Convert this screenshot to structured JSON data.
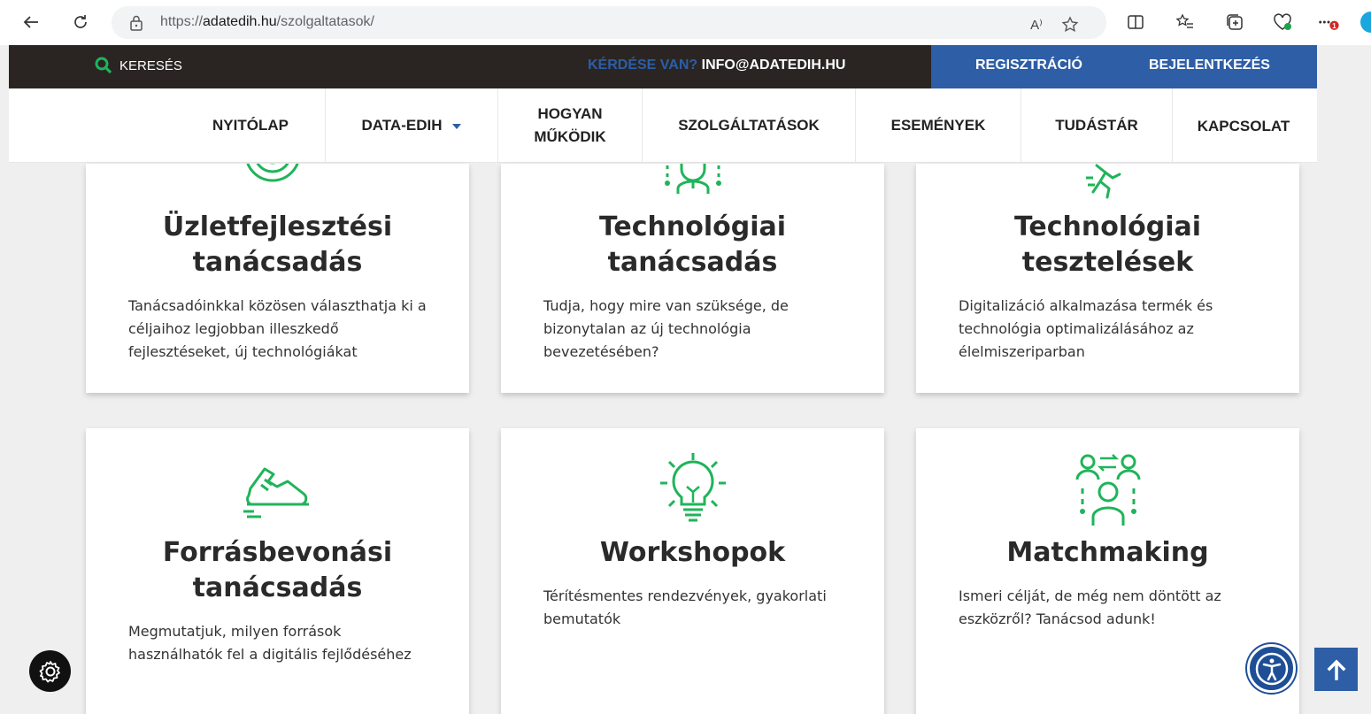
{
  "browser": {
    "url_prefix": "https://",
    "url_domain": "adatedih.hu",
    "url_path": "/szolgaltatasok/",
    "read_aloud_label": "A⁾",
    "notification_count": "1"
  },
  "topbar": {
    "search_label": "KERESÉS",
    "question_label": "KÉRDÉSE VAN?",
    "email": "INFO@ADATEDIH.HU",
    "register_label": "REGISZTRÁCIÓ",
    "login_label": "BEJELENTKEZÉS"
  },
  "nav": {
    "items": [
      {
        "label": "NYITÓLAP"
      },
      {
        "label": "DATA-EDIH"
      },
      {
        "label_line1": "HOGYAN",
        "label_line2": "MŰKÖDIK"
      },
      {
        "label": "SZOLGÁLTATÁSOK"
      },
      {
        "label": "ESEMÉNYEK"
      },
      {
        "label": "TUDÁSTÁR"
      },
      {
        "label": "KAPCSOLAT"
      }
    ]
  },
  "services": [
    {
      "title_line1": "Üzletfejlesztési",
      "title_line2": "tanácsadás",
      "text": "Tanácsadóinkkal közösen választhatja ki a céljaihoz legjobban illeszkedő fejlesztéseket, új technológiákat",
      "icon": "target-icon"
    },
    {
      "title_line1": "Technológiai",
      "title_line2": "tanácsadás",
      "text": "Tudja, hogy mire van szüksége, de bizonytalan az új technológia bevezetésében?",
      "icon": "consultant-icon"
    },
    {
      "title_line1": "Technológiai",
      "title_line2": "tesztelések",
      "text": "Digitalizáció alkalmazása termék és technológia optimalizálásához az élelmiszeriparban",
      "icon": "running-person-icon"
    },
    {
      "title_line1": "Forrásbevonási",
      "title_line2": "tanácsadás",
      "text": "Megmutatjuk, milyen források használhatók fel a digitális fejlődéséhez",
      "icon": "sneaker-icon"
    },
    {
      "title_line1": "Workshopok",
      "title_line2": "",
      "text": "Térítésmentes rendezvények, gyakorlati bemutatók",
      "icon": "lightbulb-icon"
    },
    {
      "title_line1": "Matchmaking",
      "title_line2": "",
      "text": "Ismeri célját, de még nem döntött az eszközről? Tanácsod adunk!",
      "icon": "people-exchange-icon"
    }
  ],
  "colors": {
    "accent_green": "#1fb45a",
    "brand_blue": "#2d5ea6",
    "topbar_dark": "#2a2523"
  }
}
